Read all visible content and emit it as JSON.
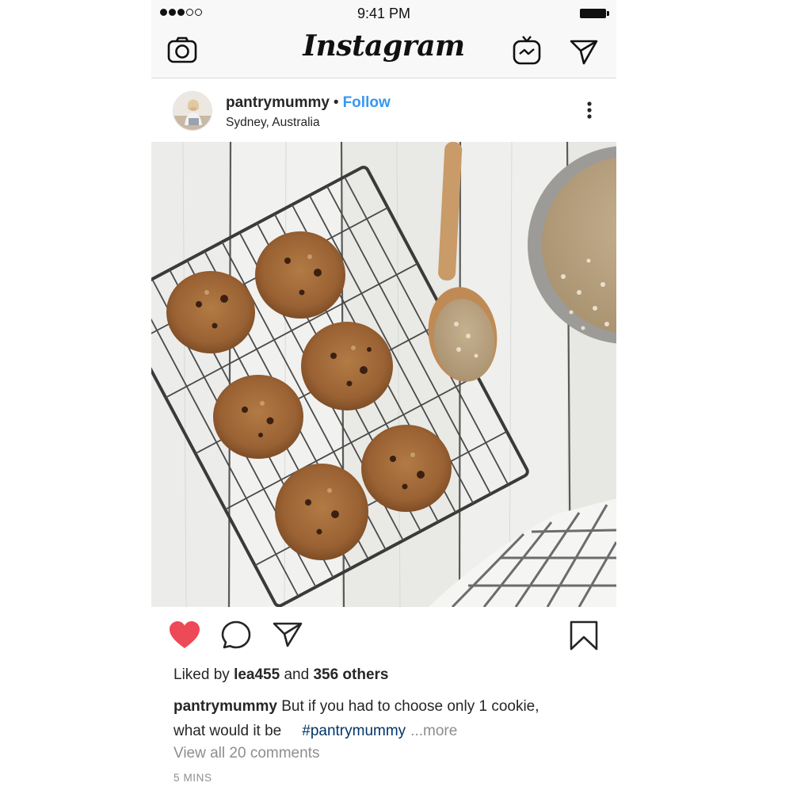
{
  "status_bar": {
    "time": "9:41 PM",
    "signal_dots_filled": 3,
    "signal_dots_total": 5
  },
  "header": {
    "logo": "Instagram",
    "icons": [
      "camera-icon",
      "igtv-icon",
      "direct-message-icon"
    ]
  },
  "post": {
    "username": "pantrymummy",
    "separator": "•",
    "follow_label": "Follow",
    "location": "Sydney, Australia",
    "options_icon": "more-vertical-icon",
    "photo_icon": "cookie-photo",
    "actions": {
      "like_icon": "heart-filled-icon",
      "comment_icon": "comment-icon",
      "share_icon": "share-icon",
      "save_icon": "bookmark-icon",
      "liked": true
    },
    "likes": {
      "prefix": "Liked by",
      "liker": "lea455",
      "joiner": "and",
      "others": "356 others"
    },
    "caption": {
      "username": "pantrymummy",
      "text_line1": "But if you had to choose only 1 cookie,",
      "text_line2": "what would it be",
      "hashtag": "#pantrymummy",
      "more_label": "...more"
    },
    "view_comments": "View all 20 comments",
    "time_ago": "5 MINS"
  },
  "colors": {
    "link_blue": "#3897f0",
    "hashtag": "#003569",
    "like_red": "#ed4956",
    "muted": "#8e8e8e",
    "text": "#262626"
  }
}
